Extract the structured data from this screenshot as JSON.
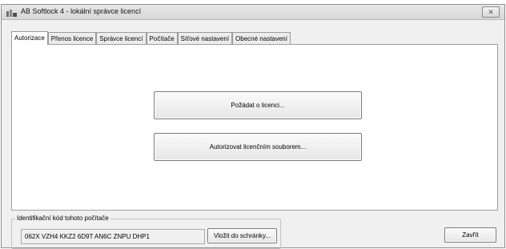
{
  "window": {
    "title": "AB Softlock 4  -  lokální správce licencí",
    "icon": "app-icon",
    "close_icon": "close-icon",
    "close_glyph": "✕"
  },
  "tabs": [
    {
      "label": "Autorizace",
      "active": true
    },
    {
      "label": "Přenos licence",
      "active": false
    },
    {
      "label": "Správce licencí",
      "active": false
    },
    {
      "label": "Počítače",
      "active": false
    },
    {
      "label": "Síťové nastavení",
      "active": false
    },
    {
      "label": "Obecné nastavení",
      "active": false
    }
  ],
  "panel": {
    "request_button": "Požádat o licenci...",
    "authorize_button": "Autorizovat licenčním souborem..."
  },
  "identification": {
    "legend": "Identifikační kód tohoto počítače",
    "code": "062X VZH4 KKZ2 6D9T AN6C ZNPU DHP1",
    "copy_button": "Vložit do schránky..."
  },
  "footer": {
    "close_button": "Zavřít"
  }
}
